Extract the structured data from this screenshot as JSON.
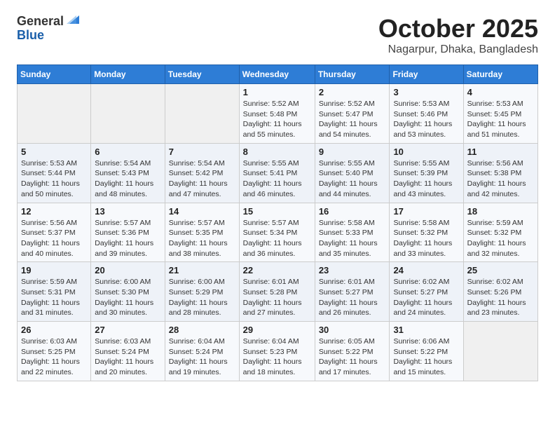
{
  "header": {
    "logo_general": "General",
    "logo_blue": "Blue",
    "title": "October 2025",
    "location": "Nagarpur, Dhaka, Bangladesh"
  },
  "days_of_week": [
    "Sunday",
    "Monday",
    "Tuesday",
    "Wednesday",
    "Thursday",
    "Friday",
    "Saturday"
  ],
  "weeks": [
    [
      {
        "day": "",
        "info": ""
      },
      {
        "day": "",
        "info": ""
      },
      {
        "day": "",
        "info": ""
      },
      {
        "day": "1",
        "info": "Sunrise: 5:52 AM\nSunset: 5:48 PM\nDaylight: 11 hours\nand 55 minutes."
      },
      {
        "day": "2",
        "info": "Sunrise: 5:52 AM\nSunset: 5:47 PM\nDaylight: 11 hours\nand 54 minutes."
      },
      {
        "day": "3",
        "info": "Sunrise: 5:53 AM\nSunset: 5:46 PM\nDaylight: 11 hours\nand 53 minutes."
      },
      {
        "day": "4",
        "info": "Sunrise: 5:53 AM\nSunset: 5:45 PM\nDaylight: 11 hours\nand 51 minutes."
      }
    ],
    [
      {
        "day": "5",
        "info": "Sunrise: 5:53 AM\nSunset: 5:44 PM\nDaylight: 11 hours\nand 50 minutes."
      },
      {
        "day": "6",
        "info": "Sunrise: 5:54 AM\nSunset: 5:43 PM\nDaylight: 11 hours\nand 48 minutes."
      },
      {
        "day": "7",
        "info": "Sunrise: 5:54 AM\nSunset: 5:42 PM\nDaylight: 11 hours\nand 47 minutes."
      },
      {
        "day": "8",
        "info": "Sunrise: 5:55 AM\nSunset: 5:41 PM\nDaylight: 11 hours\nand 46 minutes."
      },
      {
        "day": "9",
        "info": "Sunrise: 5:55 AM\nSunset: 5:40 PM\nDaylight: 11 hours\nand 44 minutes."
      },
      {
        "day": "10",
        "info": "Sunrise: 5:55 AM\nSunset: 5:39 PM\nDaylight: 11 hours\nand 43 minutes."
      },
      {
        "day": "11",
        "info": "Sunrise: 5:56 AM\nSunset: 5:38 PM\nDaylight: 11 hours\nand 42 minutes."
      }
    ],
    [
      {
        "day": "12",
        "info": "Sunrise: 5:56 AM\nSunset: 5:37 PM\nDaylight: 11 hours\nand 40 minutes."
      },
      {
        "day": "13",
        "info": "Sunrise: 5:57 AM\nSunset: 5:36 PM\nDaylight: 11 hours\nand 39 minutes."
      },
      {
        "day": "14",
        "info": "Sunrise: 5:57 AM\nSunset: 5:35 PM\nDaylight: 11 hours\nand 38 minutes."
      },
      {
        "day": "15",
        "info": "Sunrise: 5:57 AM\nSunset: 5:34 PM\nDaylight: 11 hours\nand 36 minutes."
      },
      {
        "day": "16",
        "info": "Sunrise: 5:58 AM\nSunset: 5:33 PM\nDaylight: 11 hours\nand 35 minutes."
      },
      {
        "day": "17",
        "info": "Sunrise: 5:58 AM\nSunset: 5:32 PM\nDaylight: 11 hours\nand 33 minutes."
      },
      {
        "day": "18",
        "info": "Sunrise: 5:59 AM\nSunset: 5:32 PM\nDaylight: 11 hours\nand 32 minutes."
      }
    ],
    [
      {
        "day": "19",
        "info": "Sunrise: 5:59 AM\nSunset: 5:31 PM\nDaylight: 11 hours\nand 31 minutes."
      },
      {
        "day": "20",
        "info": "Sunrise: 6:00 AM\nSunset: 5:30 PM\nDaylight: 11 hours\nand 30 minutes."
      },
      {
        "day": "21",
        "info": "Sunrise: 6:00 AM\nSunset: 5:29 PM\nDaylight: 11 hours\nand 28 minutes."
      },
      {
        "day": "22",
        "info": "Sunrise: 6:01 AM\nSunset: 5:28 PM\nDaylight: 11 hours\nand 27 minutes."
      },
      {
        "day": "23",
        "info": "Sunrise: 6:01 AM\nSunset: 5:27 PM\nDaylight: 11 hours\nand 26 minutes."
      },
      {
        "day": "24",
        "info": "Sunrise: 6:02 AM\nSunset: 5:27 PM\nDaylight: 11 hours\nand 24 minutes."
      },
      {
        "day": "25",
        "info": "Sunrise: 6:02 AM\nSunset: 5:26 PM\nDaylight: 11 hours\nand 23 minutes."
      }
    ],
    [
      {
        "day": "26",
        "info": "Sunrise: 6:03 AM\nSunset: 5:25 PM\nDaylight: 11 hours\nand 22 minutes."
      },
      {
        "day": "27",
        "info": "Sunrise: 6:03 AM\nSunset: 5:24 PM\nDaylight: 11 hours\nand 20 minutes."
      },
      {
        "day": "28",
        "info": "Sunrise: 6:04 AM\nSunset: 5:24 PM\nDaylight: 11 hours\nand 19 minutes."
      },
      {
        "day": "29",
        "info": "Sunrise: 6:04 AM\nSunset: 5:23 PM\nDaylight: 11 hours\nand 18 minutes."
      },
      {
        "day": "30",
        "info": "Sunrise: 6:05 AM\nSunset: 5:22 PM\nDaylight: 11 hours\nand 17 minutes."
      },
      {
        "day": "31",
        "info": "Sunrise: 6:06 AM\nSunset: 5:22 PM\nDaylight: 11 hours\nand 15 minutes."
      },
      {
        "day": "",
        "info": ""
      }
    ]
  ]
}
